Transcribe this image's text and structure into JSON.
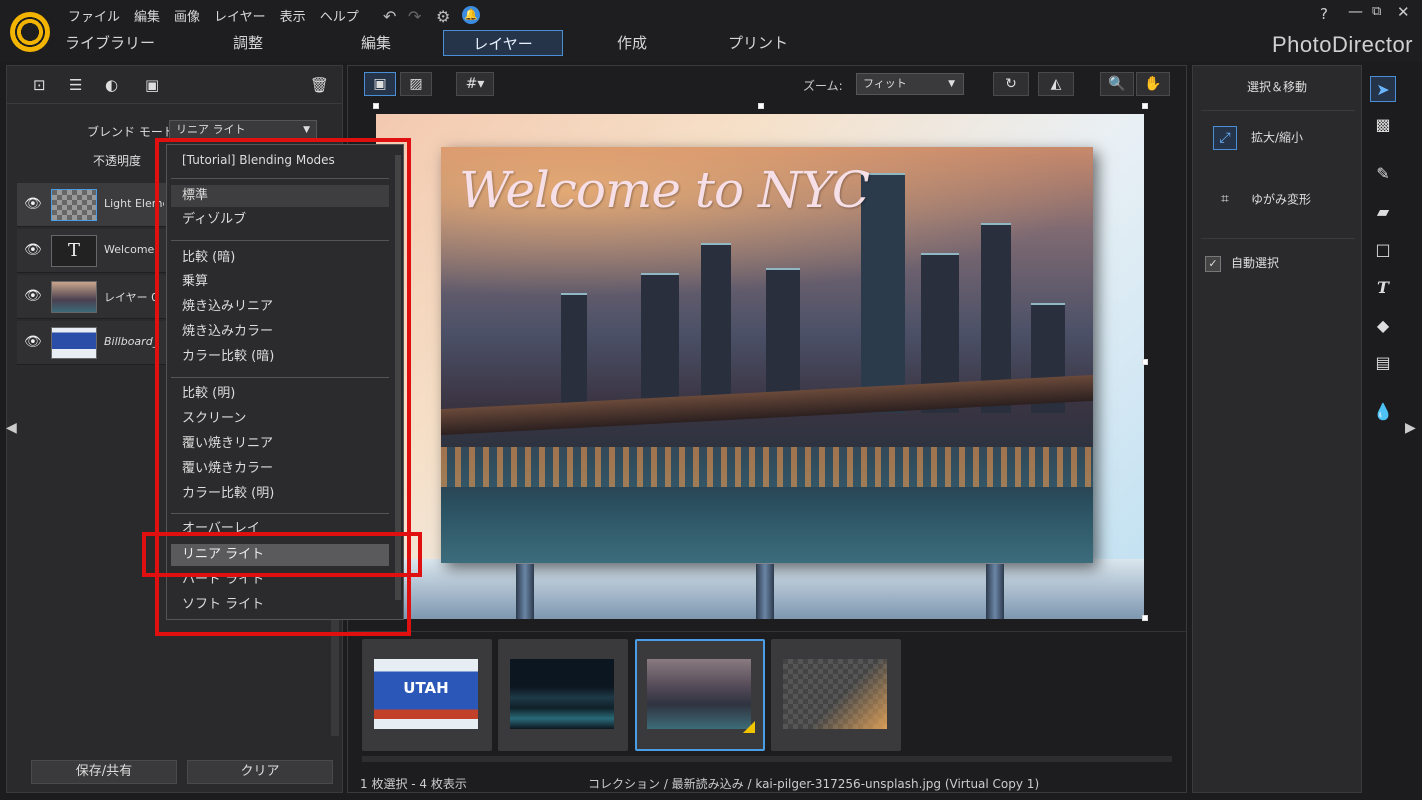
{
  "menu": [
    "ファイル",
    "編集",
    "画像",
    "レイヤー",
    "表示",
    "ヘルプ"
  ],
  "window_buttons": {
    "help": "?",
    "minimize": "—",
    "restore": "⧉",
    "close": "✕"
  },
  "tabs": [
    "ライブラリー",
    "調整",
    "編集",
    "レイヤー",
    "作成",
    "プリント"
  ],
  "active_tab": "レイヤー",
  "brand": "PhotoDirector",
  "left_panel": {
    "blend_label": "ブレンド モード:",
    "blend_value": "リニア ライト",
    "opacity_label": "不透明度",
    "layers": [
      {
        "name": "Light Eleme",
        "visible": true
      },
      {
        "name": "Welcome",
        "visible": true,
        "thumb_letter": "T"
      },
      {
        "name": "レイヤー 0",
        "visible": true
      },
      {
        "name": "Billboard_",
        "visible": true
      }
    ],
    "save_button": "保存/共有",
    "clear_button": "クリア"
  },
  "dropdown": {
    "items": [
      "[Tutorial] Blending Modes",
      "標準",
      "ディゾルブ",
      "比較 (暗)",
      "乗算",
      "焼き込みリニア",
      "焼き込みカラー",
      "カラー比較 (暗)",
      "比較 (明)",
      "スクリーン",
      "覆い焼きリニア",
      "覆い焼きカラー",
      "カラー比較 (明)",
      "オーバーレイ",
      "リニア ライト",
      "ハード ライト",
      "ソフト ライト"
    ]
  },
  "center": {
    "zoom_label": "ズーム:",
    "zoom_value": "フィット",
    "canvas_text": "Welcome to NYC",
    "film_thumb_text": "UTAH",
    "status_left": "1 枚選択 - 4 枚表示",
    "status_path": "コレクション / 最新読み込み / kai-pilger-317256-unsplash.jpg (Virtual Copy 1)"
  },
  "right_panel": {
    "title": "選択＆移動",
    "zoom_item": "拡大/縮小",
    "distort_item": "ゆがみ変形",
    "auto_select_label": "自動選択",
    "auto_select_checked": true
  },
  "colors": {
    "accent": "#4a8fd6",
    "highlight_box": "#e01010",
    "logo": "#f2b400"
  }
}
